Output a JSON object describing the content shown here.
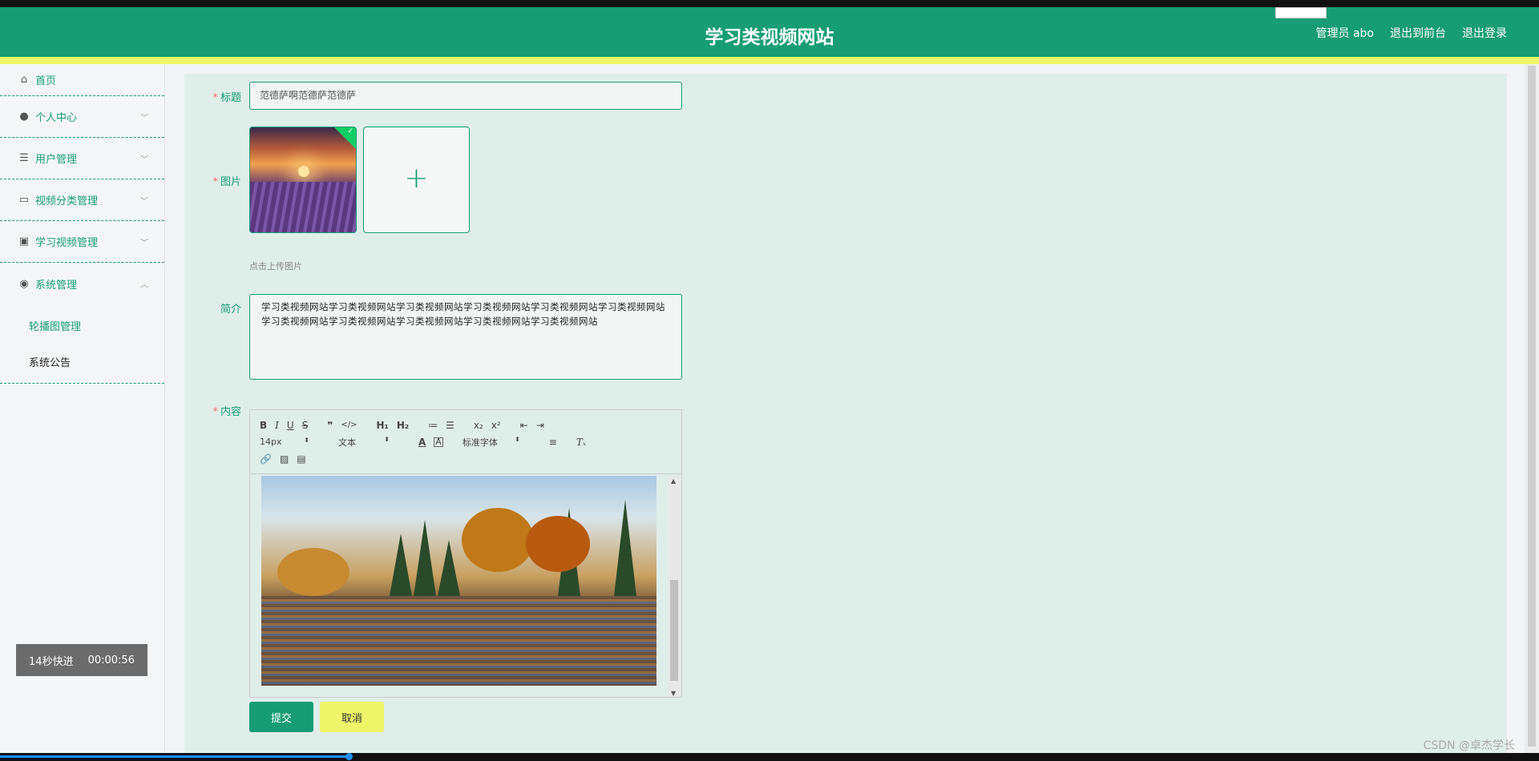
{
  "header": {
    "title": "学习类视频网站",
    "links": [
      "管理员 abo",
      "退出到前台",
      "退出登录"
    ]
  },
  "sidebar": {
    "items": [
      {
        "label": "首页",
        "icon": "home-icon"
      },
      {
        "label": "个人中心",
        "icon": "user-icon"
      },
      {
        "label": "用户管理",
        "icon": "list-icon"
      },
      {
        "label": "视频分类管理",
        "icon": "card-icon"
      },
      {
        "label": "学习视频管理",
        "icon": "clipboard-icon"
      },
      {
        "label": "系统管理",
        "icon": "location-icon"
      }
    ],
    "subitems": [
      "轮播图管理",
      "系统公告"
    ]
  },
  "timer": {
    "label": "14秒快进",
    "time": "00:00:56"
  },
  "form": {
    "title_label": "标题",
    "title_value": "范德萨啊范德萨范德萨",
    "image_label": "图片",
    "upload_hint": "点击上传图片",
    "intro_label": "简介",
    "intro_value": "学习类视频网站学习类视频网站学习类视频网站学习类视频网站学习类视频网站学习类视频网站学习类视频网站学习类视频网站学习类视频网站学习类视频网站学习类视频网站",
    "content_label": "内容",
    "submit_label": "提交",
    "cancel_label": "取消"
  },
  "editor": {
    "font_size": "14px",
    "format": "文本",
    "font_family": "标准字体"
  },
  "watermark": "CSDN @卓杰学长"
}
